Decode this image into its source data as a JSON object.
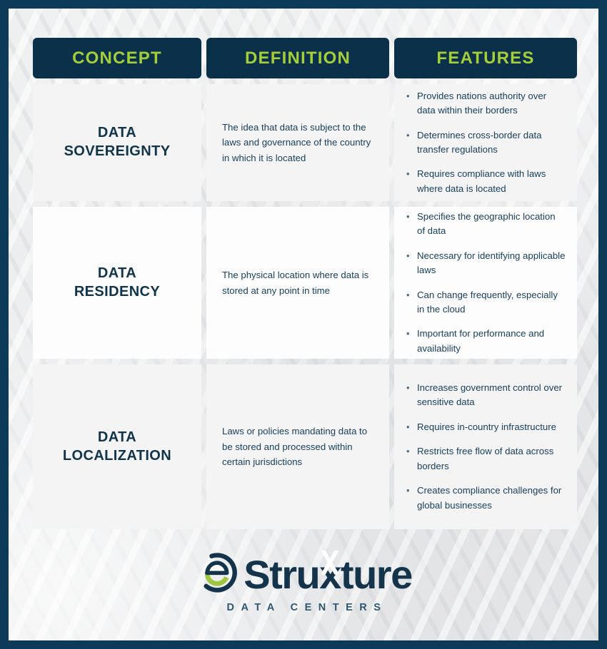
{
  "theme": {
    "frame_color": "#0d3a56",
    "header_bg": "#0b3049",
    "header_text": "#a6ce39",
    "body_text": "#17405c",
    "concept_text": "#10344c",
    "cell_bg_light": "#f4f4f5",
    "cell_bg_white": "#fdfdfd"
  },
  "table": {
    "headers": [
      {
        "label": "CONCEPT"
      },
      {
        "label": "DEFINITION"
      },
      {
        "label": "FEATURES"
      }
    ],
    "rows": [
      {
        "concept": "DATA\nSOVEREIGNTY",
        "concept_line1": "DATA",
        "concept_line2": "SOVEREIGNTY",
        "definition": "The idea that data is subject to the laws and governance of the country in which it is located",
        "features": [
          "Provides nations authority over data within their borders",
          "Determines cross-border data transfer regulations",
          "Requires compliance with laws where data is located"
        ]
      },
      {
        "concept": "DATA\nRESIDENCY",
        "concept_line1": "DATA",
        "concept_line2": "RESIDENCY",
        "definition": "The physical location where data is stored at any point in time",
        "features": [
          "Specifies the geographic location of data",
          "Necessary for identifying applicable laws",
          "Can change frequently, especially in the cloud",
          "Important for performance and availability"
        ]
      },
      {
        "concept": "DATA\nLOCALIZATION",
        "concept_line1": "DATA",
        "concept_line2": "LOCALIZATION",
        "definition": "Laws or policies mandating data to be stored and processed within certain jurisdictions",
        "features": [
          "Increases government control over sensitive data",
          "Requires in-country infrastructure",
          "Restricts free flow of data across borders",
          "Creates compliance challenges for global businesses"
        ]
      }
    ],
    "bullet_glyph": "•"
  },
  "footer": {
    "logo_part1": "Stru",
    "logo_x": "x",
    "logo_part2": "ture",
    "logo_tagline": "DATA CENTERS",
    "logo_mark_name": "estruxture-e-mark",
    "mark_ring_color": "#13344b",
    "mark_accent_color": "#9fc63f"
  }
}
